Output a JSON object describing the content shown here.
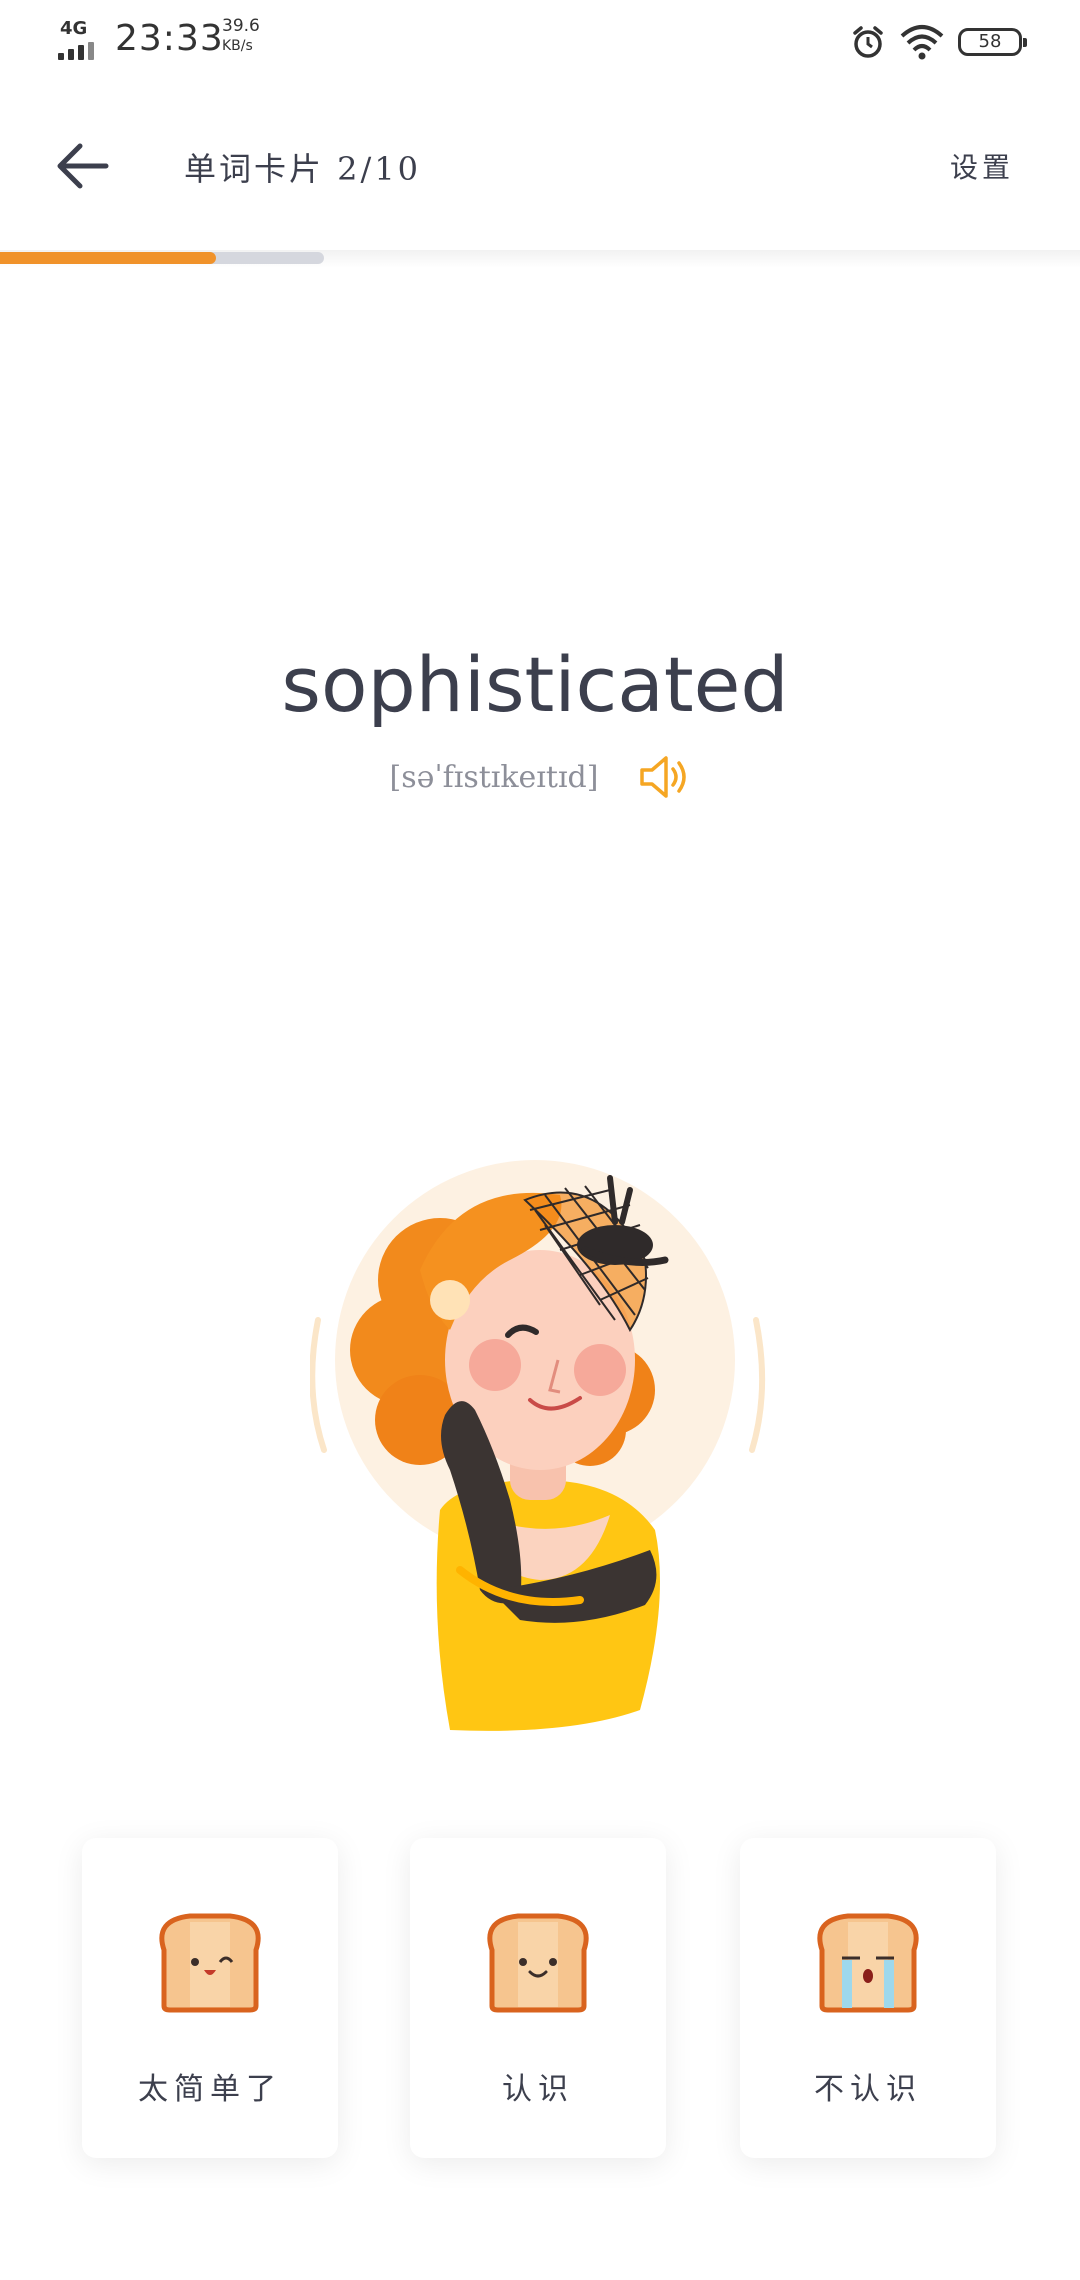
{
  "status_bar": {
    "network": "4G",
    "time": "23:33",
    "speed_value": "39.6",
    "speed_unit": "KB/s",
    "battery": "58"
  },
  "header": {
    "title": "单词卡片  2/10",
    "settings_label": "设置"
  },
  "progress": {
    "current": 2,
    "total": 10,
    "fraction": 0.2
  },
  "word": {
    "text": "sophisticated",
    "phonetic": "[səˈfɪstɪkeɪtɪd]"
  },
  "icons": {
    "back": "back-arrow-icon",
    "speaker": "speaker-icon",
    "illustration": "elegant-lady-illustration"
  },
  "colors": {
    "accent": "#f0922a",
    "text": "#3c3f4d",
    "track": "#d5d7de",
    "speaker": "#f5a623"
  },
  "options": [
    {
      "label": "太简单了",
      "face": "wink"
    },
    {
      "label": "认识",
      "face": "smile"
    },
    {
      "label": "不认识",
      "face": "cry"
    }
  ]
}
